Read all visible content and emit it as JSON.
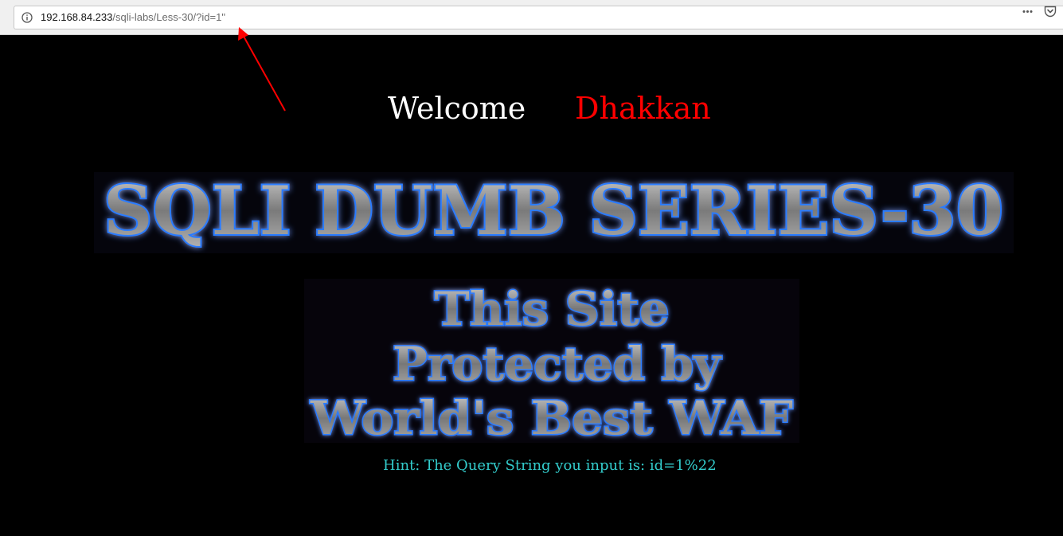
{
  "browser": {
    "url_host": "192.168.84.233",
    "url_path": "/sqli-labs/Less-30/?id=1\"",
    "icons": {
      "info": "info-icon",
      "page_actions": "page-actions-icon",
      "pocket": "pocket-icon"
    }
  },
  "annotation": {
    "arrow_color": "#ff0000"
  },
  "page": {
    "welcome_word": "Welcome",
    "welcome_name": "Dhakkan",
    "banner_title_text": "SQLI DUMB SERIES-30",
    "banner_waf_lines": [
      "This Site",
      "Protected by",
      "World's Best WAF"
    ],
    "hint_text": "Hint: The Query String you input is: id=1%22"
  },
  "colors": {
    "background": "#000000",
    "welcome": "#ffffff",
    "name": "#ff0000",
    "hint": "#33cccc",
    "banner_glow": "#1e6bff",
    "banner_fill": "#8a8a8a"
  }
}
